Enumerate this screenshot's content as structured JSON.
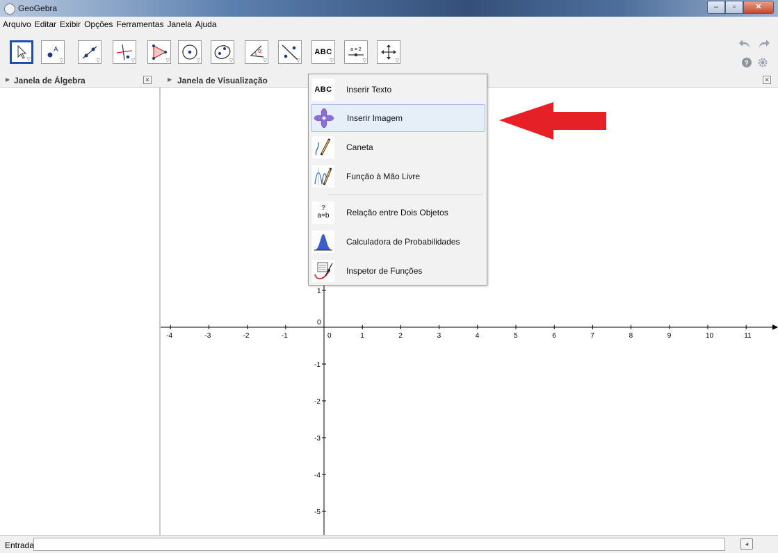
{
  "window": {
    "title": "GeoGebra"
  },
  "menu": [
    "Arquivo",
    "Editar",
    "Exibir",
    "Opções",
    "Ferramentas",
    "Janela",
    "Ajuda"
  ],
  "toolbar": {
    "tools": [
      {
        "name": "move-tool",
        "icon": "cursor-arrow-icon"
      },
      {
        "name": "point-tool",
        "icon": "point-icon",
        "label": "A"
      },
      {
        "name": "line-tool",
        "icon": "line-through-points-icon"
      },
      {
        "name": "perpendicular-tool",
        "icon": "perpendicular-line-icon"
      },
      {
        "name": "polygon-tool",
        "icon": "polygon-icon"
      },
      {
        "name": "circle-tool",
        "icon": "circle-center-point-icon"
      },
      {
        "name": "conic-tool",
        "icon": "ellipse-icon"
      },
      {
        "name": "angle-tool",
        "icon": "angle-icon",
        "label": "α"
      },
      {
        "name": "reflect-tool",
        "icon": "reflect-line-icon"
      },
      {
        "name": "text-tool",
        "icon": "text-icon",
        "label": "ABC"
      },
      {
        "name": "slider-tool",
        "icon": "slider-icon",
        "label": "a = 2"
      },
      {
        "name": "move-view-tool",
        "icon": "move-graphics-view-icon"
      }
    ]
  },
  "algebra_panel": {
    "title": "Janela de Álgebra"
  },
  "graphics_panel": {
    "title": "Janela de Visualização"
  },
  "dropdown": {
    "items": [
      {
        "label": "Inserir Texto",
        "icon": "text-icon",
        "icon_text": "ABC"
      },
      {
        "label": "Inserir Imagem",
        "icon": "image-icon",
        "highlighted": true
      },
      {
        "label": "Caneta",
        "icon": "pen-icon"
      },
      {
        "label": "Função à Mão Livre",
        "icon": "freehand-function-icon"
      },
      {
        "label": "Relação entre Dois Objetos",
        "icon": "relation-icon",
        "icon_text": "a=b",
        "icon_text2": "?"
      },
      {
        "label": "Calculadora de Probabilidades",
        "icon": "probability-calculator-icon"
      },
      {
        "label": "Inspetor de Funções",
        "icon": "function-inspector-icon"
      }
    ]
  },
  "axes": {
    "x_ticks": [
      "-4",
      "-3",
      "-2",
      "-1",
      "0",
      "1",
      "2",
      "3",
      "4",
      "5",
      "6",
      "7",
      "8",
      "9",
      "10",
      "11"
    ],
    "y_ticks": [
      "1",
      "0",
      "-1",
      "-2",
      "-3",
      "-4",
      "-5"
    ]
  },
  "input_bar": {
    "label": "Entrada:",
    "value": ""
  },
  "colors": {
    "annotation_arrow": "#e52127",
    "selected_tool_border": "#1b4fa8"
  }
}
